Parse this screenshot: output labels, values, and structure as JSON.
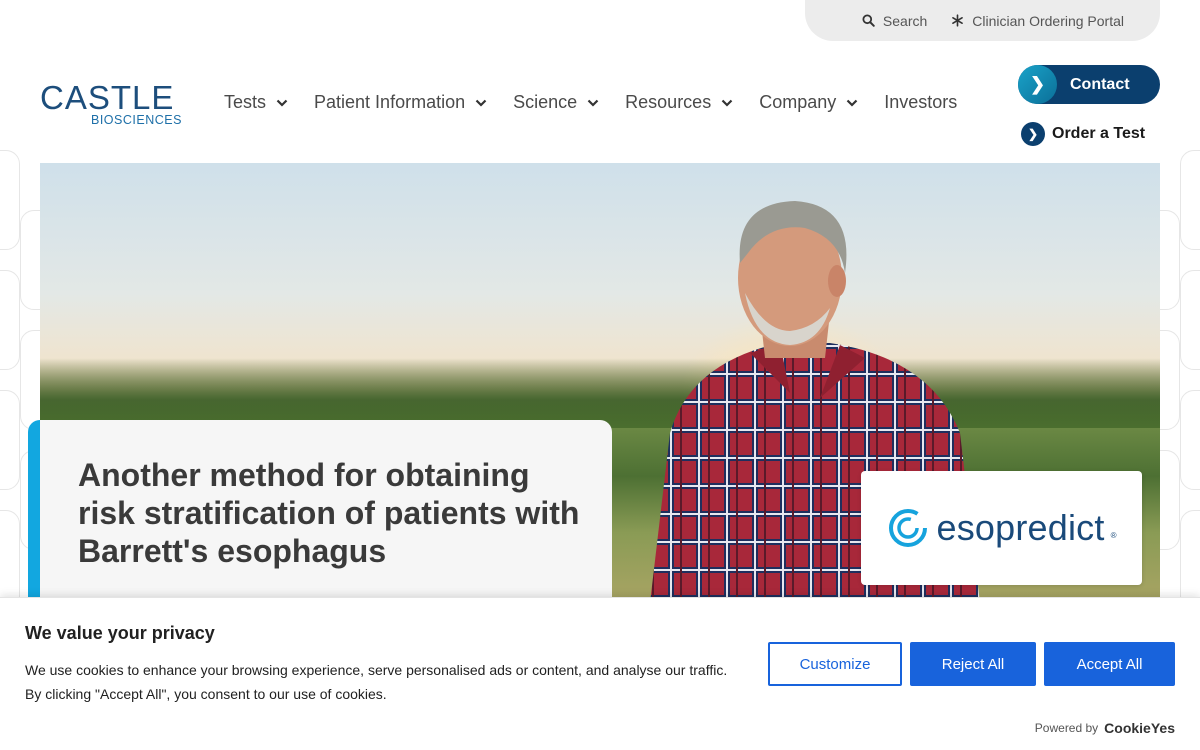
{
  "utility": {
    "search_label": "Search",
    "portal_label": "Clinician Ordering Portal"
  },
  "logo": {
    "main": "CASTLE",
    "sub": "BIOSCIENCES"
  },
  "nav": {
    "items": [
      {
        "label": "Tests",
        "dropdown": true
      },
      {
        "label": "Patient Information",
        "dropdown": true
      },
      {
        "label": "Science",
        "dropdown": true
      },
      {
        "label": "Resources",
        "dropdown": true
      },
      {
        "label": "Company",
        "dropdown": true
      },
      {
        "label": "Investors",
        "dropdown": false
      }
    ],
    "contact_label": "Contact",
    "order_label": "Order a Test"
  },
  "hero": {
    "title": "Another method for obtaining risk stratification of patients with Barrett's esophagus",
    "product_logo": "esopredict",
    "product_reg": "®"
  },
  "cookie": {
    "title": "We value your privacy",
    "text": "We use cookies to enhance your browsing experience, serve personalised ads or content, and analyse our traffic. By clicking \"Accept All\", you consent to our use of cookies.",
    "customize_label": "Customize",
    "reject_label": "Reject All",
    "accept_label": "Accept All",
    "powered_by": "Powered by",
    "powered_brand": "CookieYes"
  },
  "colors": {
    "brand_navy": "#0b3f6e",
    "accent_cyan": "#12a7e0",
    "cookie_blue": "#1863dc"
  }
}
